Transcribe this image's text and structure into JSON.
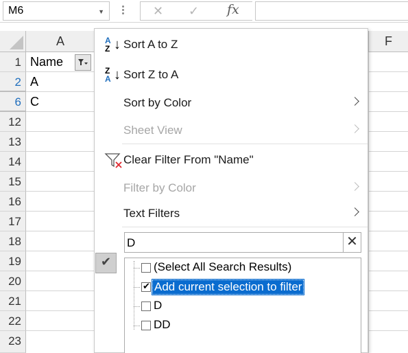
{
  "formula_bar": {
    "name_box": "M6",
    "formula": ""
  },
  "grid": {
    "columns": [
      "A",
      "F"
    ],
    "rows": [
      "1",
      "2",
      "6",
      "12",
      "13",
      "14",
      "15",
      "16",
      "17",
      "18",
      "19",
      "20",
      "21",
      "22",
      "23"
    ],
    "header_cell": "Name",
    "cells": [
      "A",
      "C"
    ]
  },
  "menu": {
    "sort_az": "Sort A to Z",
    "sort_za": "Sort Z to A",
    "sort_by_color": "Sort by Color",
    "sheet_view": "Sheet View",
    "clear_filter": "Clear Filter From \"Name\"",
    "filter_by_color": "Filter by Color",
    "text_filters": "Text Filters",
    "search_value": "D",
    "list": [
      {
        "label": "(Select All Search Results)",
        "checked": false
      },
      {
        "label": "Add current selection to filter",
        "checked": true
      },
      {
        "label": "D",
        "checked": false
      },
      {
        "label": "DD",
        "checked": false
      }
    ]
  },
  "colors": {
    "selected_row_header": "#1f6ebd",
    "highlight": "#0a6ccf",
    "clear_filter_x": "#e0282f"
  }
}
